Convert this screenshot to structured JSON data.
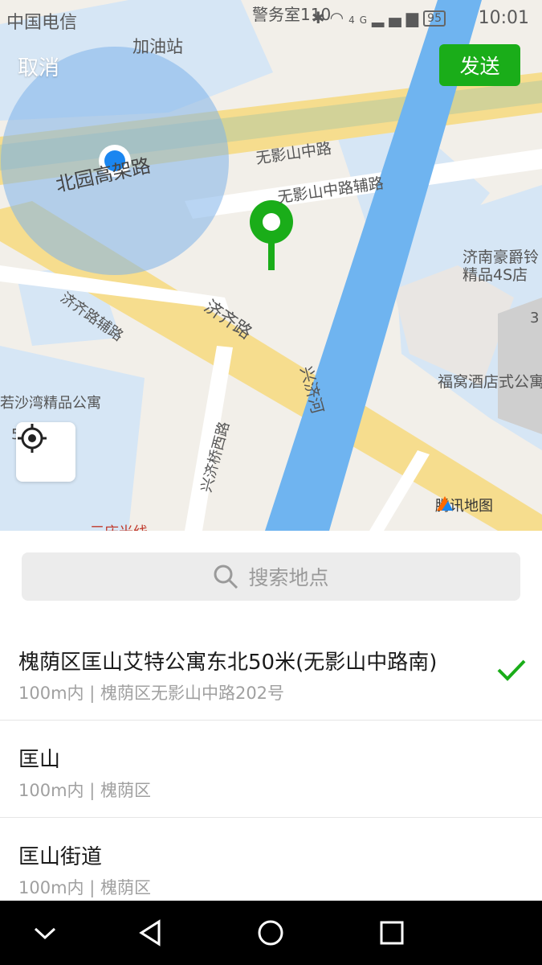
{
  "status_bar": {
    "carrier": "中国电信",
    "time": "10:01",
    "battery": "95",
    "network": "4G"
  },
  "header": {
    "cancel_label": "取消",
    "send_label": "发送"
  },
  "map": {
    "labels": {
      "gas_station": "加油站",
      "police": "警务室110",
      "beiyuan": "北园高架路",
      "wuyingshan": "无影山中路",
      "wuyingshan_aux": "无影山中路辅路",
      "jiqi": "济齐路",
      "jiqi_aux": "济齐路辅路",
      "xingji_river": "兴济河",
      "xingji_bridge": "兴济桥西路",
      "haojue": "济南豪爵铃",
      "haojue_2": "精品4S店",
      "fuwo": "福窝酒店式公寓",
      "ruoshawan": "若沙湾精品公寓",
      "sanjiang": "三庆光线",
      "num3": "3",
      "num5": "5"
    },
    "brand": "腾讯地图",
    "colors": {
      "accent_green": "#1aad19",
      "user_dot": "#1a86f0",
      "water": "#6fb4f0"
    }
  },
  "search": {
    "placeholder": "搜索地点",
    "icon": "search-icon"
  },
  "results": [
    {
      "title": "槐荫区匡山艾特公寓东北50米(无影山中路南)",
      "sub": "100m内 | 槐荫区无影山中路202号",
      "selected": true
    },
    {
      "title": "匡山",
      "sub": "100m内 | 槐荫区",
      "selected": false
    },
    {
      "title": "匡山街道",
      "sub": "100m内 | 槐荫区",
      "selected": false
    }
  ],
  "nav": {
    "icons": [
      "chevron-down-icon",
      "back-icon",
      "home-icon",
      "recents-icon"
    ]
  }
}
